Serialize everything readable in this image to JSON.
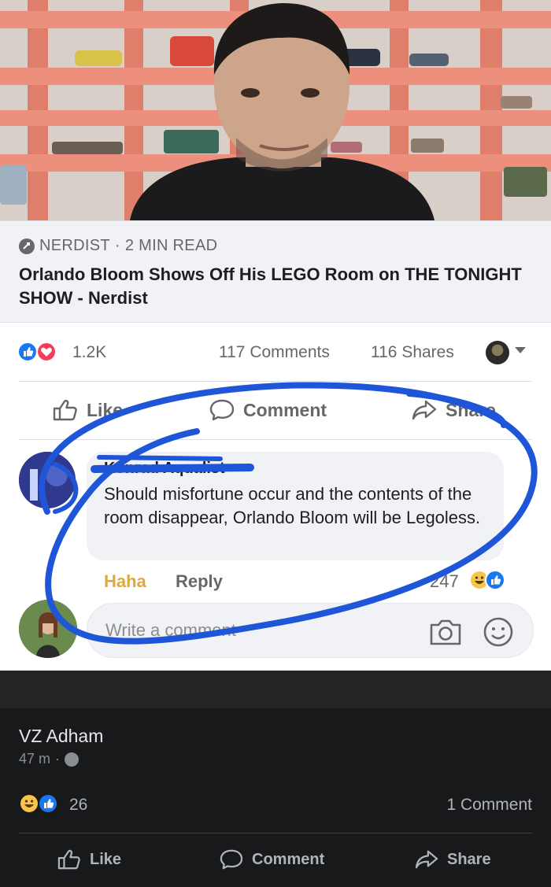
{
  "link_preview": {
    "source": "NERDIST",
    "separator": "·",
    "read_time": "2 MIN READ",
    "title": "Orlando Bloom Shows Off His LEGO Room on THE TONIGHT SHOW - Nerdist"
  },
  "stats": {
    "reaction_icons": [
      "like-icon",
      "love-icon"
    ],
    "reactions": "1.2K",
    "comments": "117 Comments",
    "shares": "116 Shares"
  },
  "actions": {
    "like": "Like",
    "comment": "Comment",
    "share": "Share"
  },
  "comment": {
    "author": "Konrad Aqualist",
    "text": "Should misfortune occur and the contents of the room disappear, Orlando Bloom will be Legoless.",
    "haha": "Haha",
    "reply": "Reply",
    "reaction_count": "247",
    "reaction_icons": [
      "haha-icon",
      "like-icon"
    ]
  },
  "composer": {
    "placeholder": "Write a comment"
  },
  "shared_post": {
    "author": "VZ Adham",
    "time": "47 m",
    "separator": "·",
    "reactions": "26",
    "comments": "1 Comment",
    "actions": {
      "like": "Like",
      "comment": "Comment",
      "share": "Share"
    }
  },
  "colors": {
    "facebook_blue": "#1877f2",
    "love_red": "#f33e58",
    "haha_yellow": "#f7c54a",
    "scribble_blue": "#1f56d8",
    "shelf_coral": "#e8826f",
    "dark_bg": "#18191a"
  }
}
